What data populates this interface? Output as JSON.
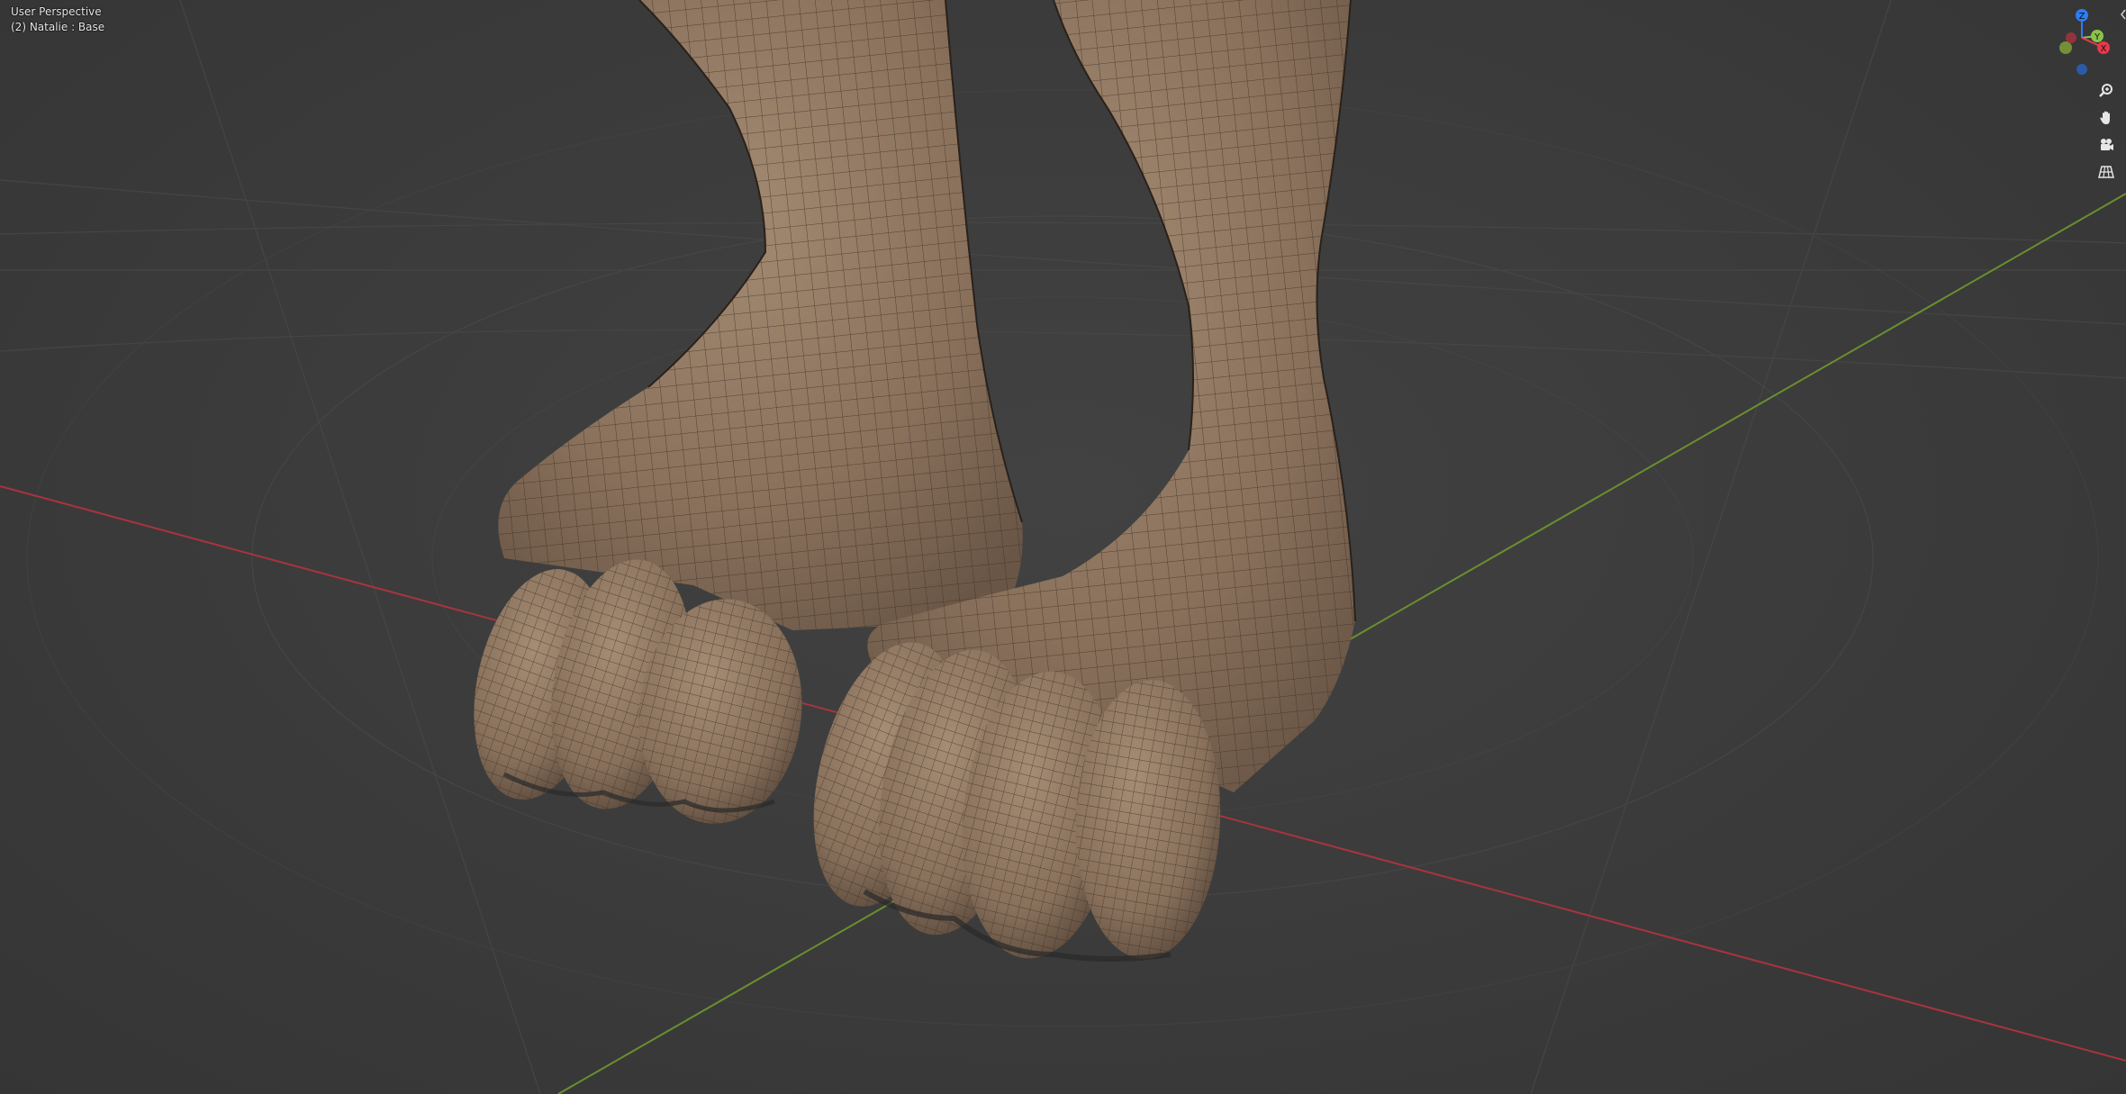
{
  "viewport": {
    "view_name": "User Perspective",
    "object_info": "(2) Natalie : Base"
  },
  "gizmo": {
    "axes": [
      {
        "label": "Z",
        "color": "#2e7cf6"
      },
      {
        "label": "Y",
        "color": "#8bc34a"
      },
      {
        "label": "X",
        "color": "#e8394a"
      }
    ]
  },
  "navigation": [
    {
      "name": "zoom-icon"
    },
    {
      "name": "hand-pan-icon"
    },
    {
      "name": "camera-icon"
    },
    {
      "name": "grid-perspective-icon"
    }
  ],
  "colors": {
    "background": "#3a3a3a",
    "grid": "#4a4a4a",
    "x_axis": "#a8343f",
    "y_axis": "#6b8f2e",
    "mesh_skin": "#8c7560",
    "wireframe": "#3b2e22"
  }
}
